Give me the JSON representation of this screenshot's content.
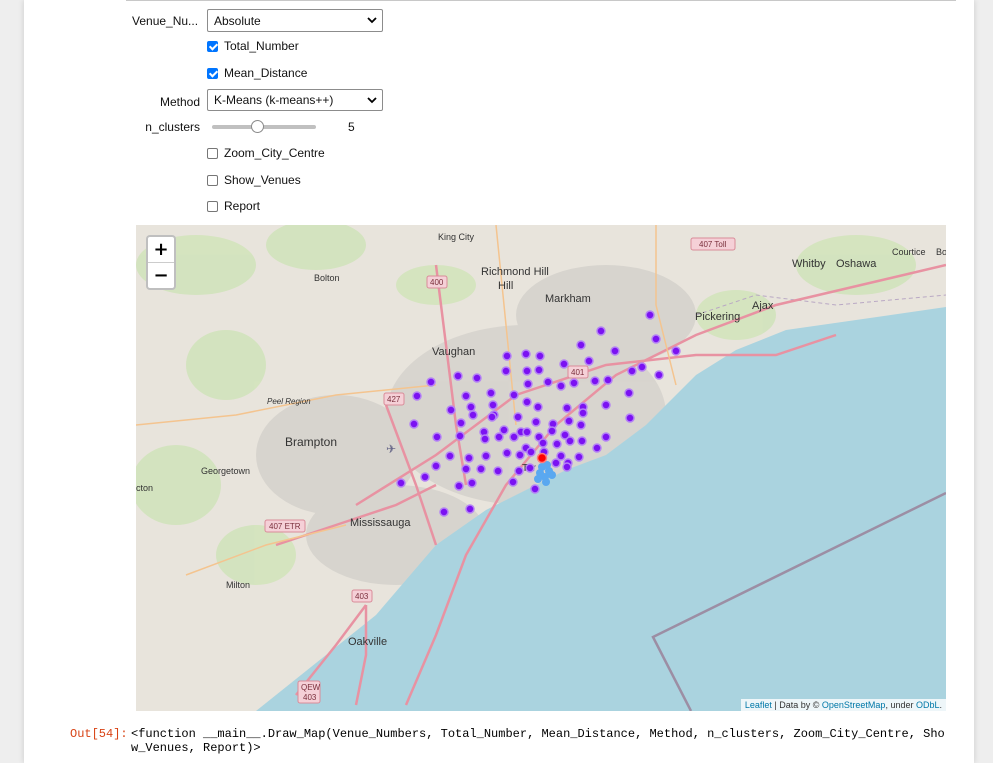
{
  "widgets": {
    "venue_numbers": {
      "label": "Venue_Nu...",
      "value": "Absolute"
    },
    "total_number": {
      "label": "Total_Number",
      "checked": true
    },
    "mean_distance": {
      "label": "Mean_Distance",
      "checked": true
    },
    "method": {
      "label": "Method",
      "value": "K-Means (k-means++)"
    },
    "n_clusters": {
      "label": "n_clusters",
      "value": "5",
      "slider_fraction": 0.4
    },
    "zoom_city_centre": {
      "label": "Zoom_City_Centre",
      "checked": false
    },
    "show_venues": {
      "label": "Show_Venues",
      "checked": false
    },
    "report": {
      "label": "Report",
      "checked": false
    }
  },
  "map": {
    "zoom_in": "+",
    "zoom_out": "−",
    "attribution": {
      "leaflet": "Leaflet",
      "data_by": " | Data by © ",
      "osm": "OpenStreetMap",
      "under": ", under ",
      "odbl": "ODbL",
      "end": "."
    },
    "places": {
      "king_city": "King City",
      "richmond_hill": "Richmond Hill",
      "markham": "Markham",
      "whitby": "Whitby",
      "oshawa": "Oshawa",
      "courtice": "Courtice",
      "bo": "Bo",
      "ajax": "Ajax",
      "pickering": "Pickering",
      "bolton": "Bolton",
      "vaughan": "Vaughan",
      "peel_region": "Peel Region",
      "brampton": "Brampton",
      "georgetown": "Georgetown",
      "cton": "cton",
      "mississauga": "Mississauga",
      "milton": "Milton",
      "oakville": "Oakville",
      "toronto": "Tor"
    },
    "shields": {
      "h407_toll": "407 Toll",
      "h400": "400",
      "h401": "401",
      "h427": "427",
      "h407_etr": "407 ETR",
      "h403": "403",
      "qew": "QEW",
      "qew_num": "403"
    },
    "colors": {
      "marker": "#7b12f2",
      "highlight": "#ff0000",
      "center": "#5aa8f0",
      "water": "#aad3df",
      "land": "#e8e4dc"
    }
  },
  "output": {
    "prompt": "Out[54]:",
    "text": "<function __main__.Draw_Map(Venue_Numbers, Total_Number, Mean_Distance, Method, n_clusters, Zoom_City_Centre, Show_Venues, Report)>"
  }
}
